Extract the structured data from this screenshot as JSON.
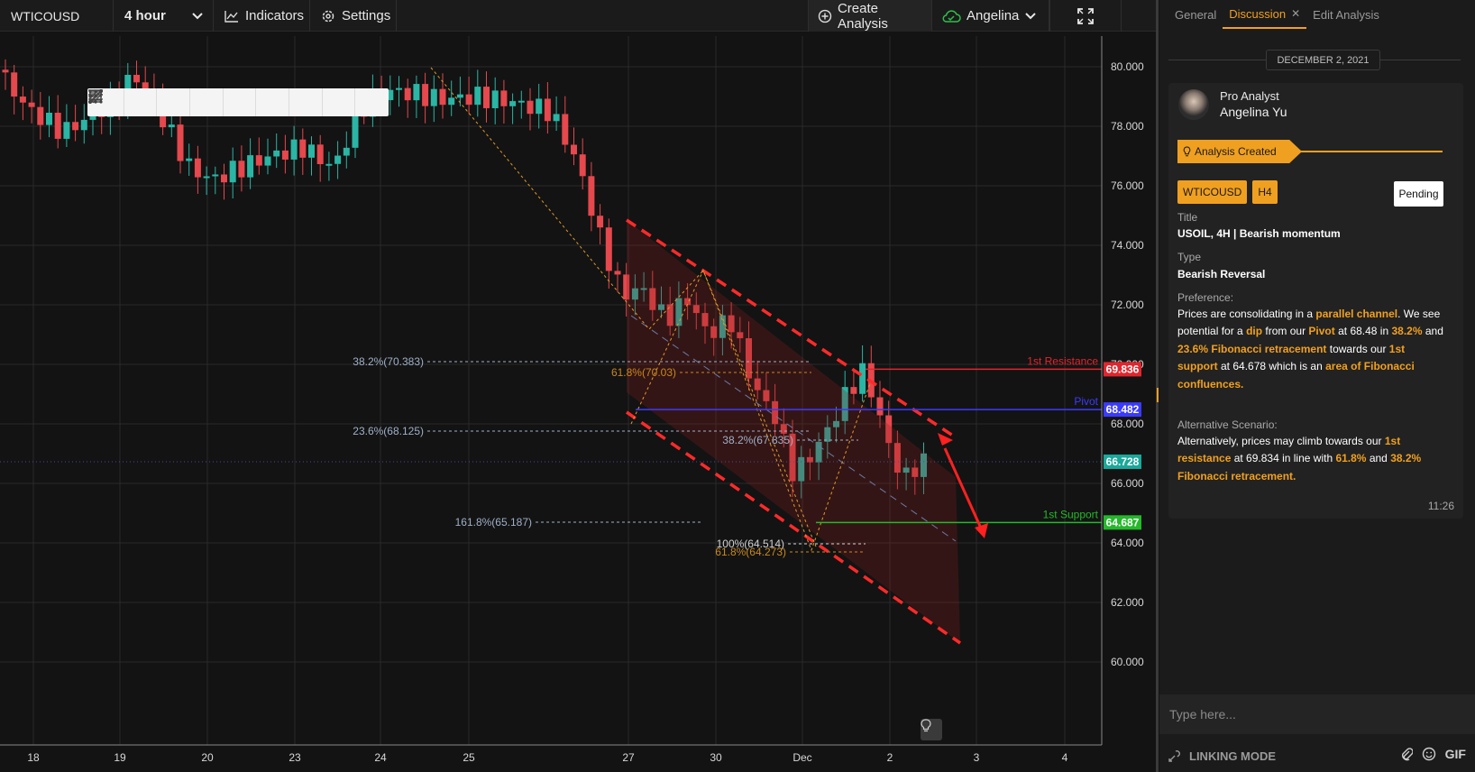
{
  "toolbar": {
    "symbol": "WTICOUSD",
    "interval": "4 hour",
    "indicators_label": "Indicators",
    "settings_label": "Settings",
    "create_label": "Create Analysis",
    "user_label": "Angelina"
  },
  "drawing_tools": [
    "drag-handle-icon",
    "multi-line-icon",
    "horizontal-line-icon",
    "trend-line-icon",
    "ray-icon",
    "extended-line-icon",
    "parallel-channel-icon",
    "pitchfork-icon",
    "rectangle-icon"
  ],
  "chart_data": {
    "type": "candlestick",
    "symbol": "WTICOUSD",
    "x_labels": [
      "18",
      "19",
      "20",
      "23",
      "24",
      "25",
      "27",
      "30",
      "Dec",
      "2",
      "3",
      "4"
    ],
    "y_ticks": [
      "80.000",
      "78.000",
      "76.000",
      "74.000",
      "72.000",
      "70.000",
      "68.000",
      "66.000",
      "64.000",
      "62.000",
      "60.000"
    ],
    "ylim": [
      59,
      81
    ],
    "current_price": "66.728",
    "levels": [
      {
        "name": "1st Resistance",
        "value": "69.836",
        "color": "#e0262e"
      },
      {
        "name": "Pivot",
        "value": "68.482",
        "color": "#3b3bff"
      },
      {
        "name": "1st Support",
        "value": "64.687",
        "color": "#25b82b"
      }
    ],
    "fib_labels": [
      {
        "text": "38.2%(70.383)",
        "color": "#9fb0c8"
      },
      {
        "text": "23.6%(68.125)",
        "color": "#9fb0c8"
      },
      {
        "text": "161.8%(65.187)",
        "color": "#9fb0c8"
      },
      {
        "text": "61.8%(70.03)",
        "color": "#c8881e"
      },
      {
        "text": "38.2%(67.835)",
        "color": "#9fb0c8"
      },
      {
        "text": "100%(64.514)",
        "color": "#d0d0d0"
      },
      {
        "text": "61.8%(64.273)",
        "color": "#c8881e"
      }
    ]
  },
  "panel": {
    "tabs": [
      "General",
      "Discussion",
      "Edit Analysis"
    ],
    "date": "DECEMBER 2, 2021",
    "role": "Pro Analyst",
    "name": "Angelina Yu",
    "created": "Analysis Created",
    "badges": [
      "WTICOUSD",
      "H4"
    ],
    "status": "Pending",
    "title_label": "Title",
    "title_value": "USOIL, 4H | Bearish momentum",
    "type_label": "Type",
    "type_value": "Bearish Reversal",
    "preference_label": "Preference:",
    "preference_parts": [
      [
        "Prices are consolidating in a ",
        false
      ],
      [
        "parallel channel",
        true
      ],
      [
        ". We see potential for a ",
        false
      ],
      [
        "dip",
        true
      ],
      [
        " from our ",
        false
      ],
      [
        "Pivot",
        true
      ],
      [
        " at 68.48 in ",
        false
      ],
      [
        "38.2%",
        true
      ],
      [
        " and ",
        false
      ],
      [
        "23.6% Fibonacci retracement",
        true
      ],
      [
        " towards our ",
        false
      ],
      [
        "1st support",
        true
      ],
      [
        " at 64.678 which is an ",
        false
      ],
      [
        "area of Fibonacci confluences.",
        true
      ]
    ],
    "alternative_label": "Alternative Scenario:",
    "alternative_parts": [
      [
        "Alternatively, prices may climb towards our ",
        false
      ],
      [
        "1st resistance",
        true
      ],
      [
        " at 69.834 in line with ",
        false
      ],
      [
        "61.8%",
        true
      ],
      [
        " and ",
        false
      ],
      [
        "38.2% Fibonacci retracement.",
        true
      ]
    ],
    "time": "11:26",
    "input_placeholder": "Type here...",
    "linking_mode": "LINKING MODE",
    "gif_label": "GIF"
  }
}
